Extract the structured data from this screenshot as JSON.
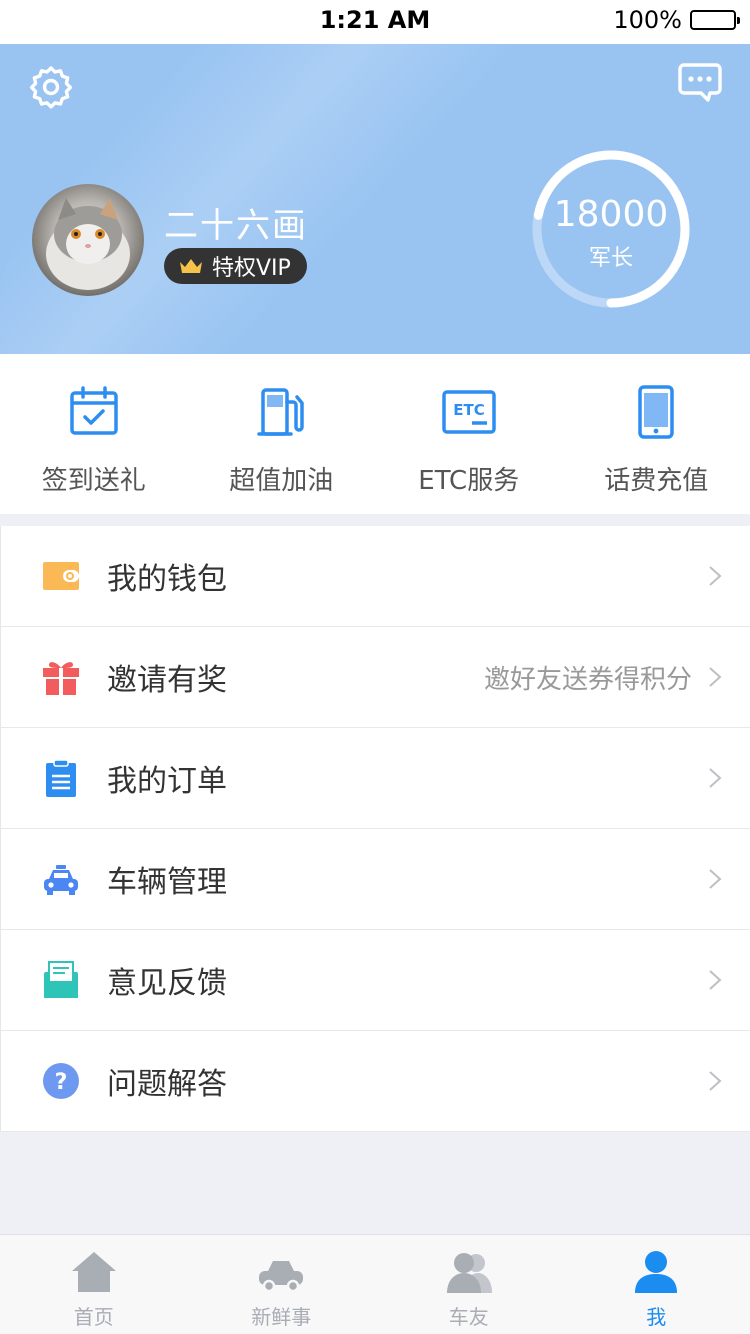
{
  "status_bar": {
    "time": "1:21 AM",
    "battery": "100%"
  },
  "profile": {
    "username": "二十六画",
    "vip_label": "特权VIP",
    "score": "18000",
    "rank": "军长",
    "score_progress_fraction": 0.72
  },
  "quick_actions": [
    {
      "label": "签到送礼",
      "icon": "calendar-check-icon"
    },
    {
      "label": "超值加油",
      "icon": "fuel-pump-icon"
    },
    {
      "label": "ETC服务",
      "icon": "etc-icon"
    },
    {
      "label": "话费充值",
      "icon": "phone-icon"
    }
  ],
  "menu": [
    {
      "label": "我的钱包",
      "icon": "wallet-icon",
      "extra": ""
    },
    {
      "label": "邀请有奖",
      "icon": "gift-icon",
      "extra": "邀好友送券得积分"
    },
    {
      "label": "我的订单",
      "icon": "clipboard-icon",
      "extra": ""
    },
    {
      "label": "车辆管理",
      "icon": "car-icon",
      "extra": ""
    },
    {
      "label": "意见反馈",
      "icon": "feedback-envelope-icon",
      "extra": ""
    },
    {
      "label": "问题解答",
      "icon": "question-icon",
      "extra": ""
    }
  ],
  "tabbar": [
    {
      "label": "首页",
      "icon": "home-icon",
      "active": false
    },
    {
      "label": "新鲜事",
      "icon": "car-icon",
      "active": false
    },
    {
      "label": "车友",
      "icon": "friends-icon",
      "active": false
    },
    {
      "label": "我",
      "icon": "person-icon",
      "active": true
    }
  ],
  "colors": {
    "header_bg": "#99c4f2",
    "accent_blue": "#1b8cf0",
    "wallet": "#fbb955",
    "gift": "#f35c5c",
    "order": "#2d8df0",
    "car": "#4c86f2",
    "feedback": "#2fc4b8",
    "question": "#6d9af0"
  }
}
